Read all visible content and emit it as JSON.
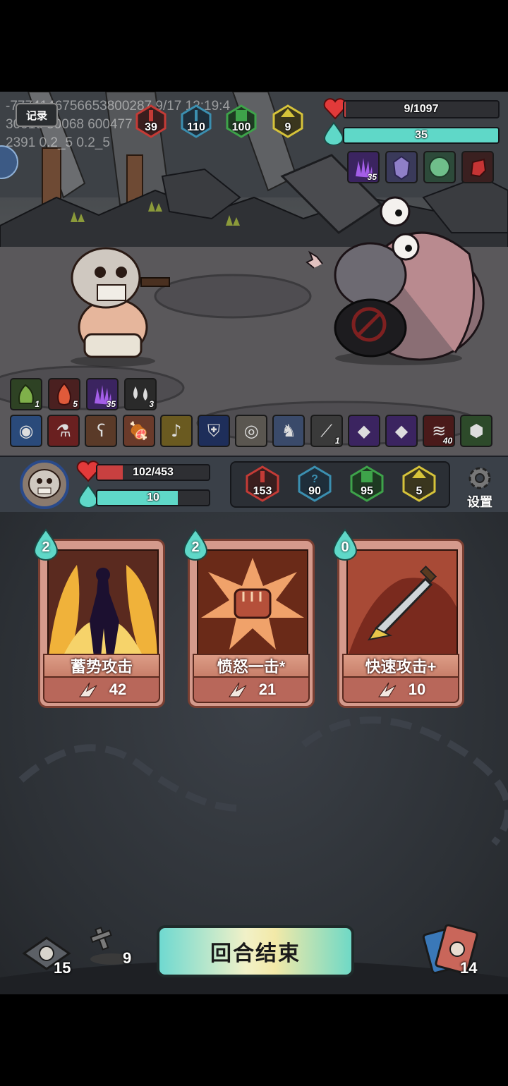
{
  "debug": {
    "line1": "-7774146756653800287 9/17 12:19:4",
    "line2": "30016 50068 600477",
    "line3": "2391 0.2_5 0.2_5"
  },
  "record_label": "记录",
  "enemy": {
    "stats": [
      {
        "icon": "attack-icon",
        "value": "39",
        "color": "#c43b36"
      },
      {
        "icon": "crit-icon",
        "value": "110",
        "color": "#3b8fb0"
      },
      {
        "icon": "defense-icon",
        "value": "100",
        "color": "#3ea34a"
      },
      {
        "icon": "speed-icon",
        "value": "9",
        "color": "#d6c33a"
      }
    ],
    "hp_text": "9/1097",
    "hp_fraction": 0.008,
    "energy_text": "35",
    "energy_fraction": 1.0,
    "buffs": [
      {
        "icon": "purple-hand-icon",
        "count": "35"
      },
      {
        "icon": "crystal-icon",
        "count": ""
      },
      {
        "icon": "green-orb-icon",
        "count": ""
      },
      {
        "icon": "red-glove-icon",
        "count": ""
      }
    ]
  },
  "player_buffs": [
    {
      "icon": "green-blob-icon",
      "count": "1"
    },
    {
      "icon": "flame-icon",
      "count": "5"
    },
    {
      "icon": "purple-hand-icon",
      "count": "35"
    },
    {
      "icon": "droplets-icon",
      "count": "3"
    }
  ],
  "relics": [
    {
      "icon": "eye-amulet-icon",
      "count": ""
    },
    {
      "icon": "red-potion-icon",
      "count": ""
    },
    {
      "icon": "teddy-bear-icon",
      "count": ""
    },
    {
      "icon": "meat-icon",
      "count": ""
    },
    {
      "icon": "golden-horn-icon",
      "count": ""
    },
    {
      "icon": "blue-shield-icon",
      "count": ""
    },
    {
      "icon": "stone-disc-icon",
      "count": ""
    },
    {
      "icon": "boots-icon",
      "count": ""
    },
    {
      "icon": "bone-icon",
      "count": "1"
    },
    {
      "icon": "purple-gem-icon",
      "count": ""
    },
    {
      "icon": "purple-gem-icon",
      "count": ""
    },
    {
      "icon": "claw-mark-icon",
      "count": "40"
    },
    {
      "icon": "green-crystal-icon",
      "count": ""
    }
  ],
  "player": {
    "hp_text": "102/453",
    "hp_fraction": 0.225,
    "energy_text": "10",
    "energy_fraction": 0.72,
    "stats": [
      {
        "icon": "attack-icon",
        "value": "153",
        "color": "#c43b36"
      },
      {
        "icon": "crit-icon",
        "value": "90",
        "color": "#3b8fb0"
      },
      {
        "icon": "defense-icon",
        "value": "95",
        "color": "#3ea34a"
      },
      {
        "icon": "speed-icon",
        "value": "5",
        "color": "#d6c33a"
      }
    ],
    "settings_label": "设置"
  },
  "hand": [
    {
      "name": "蓄势攻击",
      "cost": "2",
      "value": "42",
      "art": "silhouette-flames"
    },
    {
      "name": "愤怒一击*",
      "cost": "2",
      "value": "21",
      "art": "fist-burst"
    },
    {
      "name": "快速攻击+",
      "cost": "0",
      "value": "10",
      "art": "dagger"
    }
  ],
  "end_turn_label": "回合结束",
  "draw_pile_count": "15",
  "discard_pile_count": "9",
  "exhaust_pile_count": "14"
}
